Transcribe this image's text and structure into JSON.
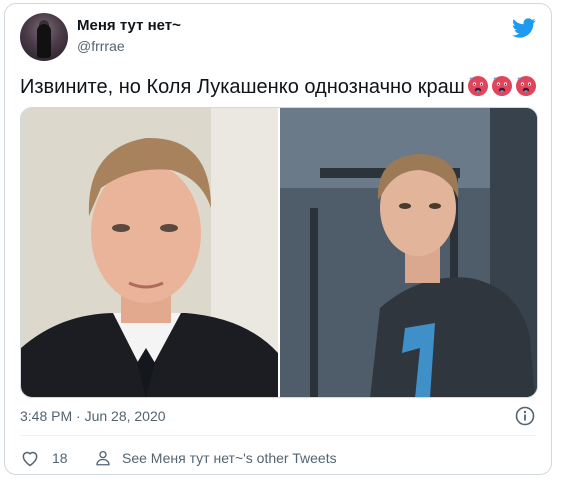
{
  "tweet": {
    "author": {
      "display_name": "Меня тут нет~",
      "handle": "@frrrae"
    },
    "text": "Извините, но Коля Лукашенко однозначно краш",
    "emoji": [
      "hot-face-emoji",
      "hot-face-emoji",
      "hot-face-emoji"
    ],
    "timestamp": "3:48 PM · Jun 28, 2020",
    "likes": "18",
    "other_tweets_label": "See Меня тут нет~'s other Tweets"
  },
  "icons": {
    "brand": "twitter-bird-icon",
    "info": "info-icon",
    "like": "heart-icon",
    "profile": "person-icon"
  },
  "colors": {
    "brand": "#1d9bf0",
    "text": "#0f1419",
    "secondary": "#536471",
    "border": "#cfd9de"
  }
}
